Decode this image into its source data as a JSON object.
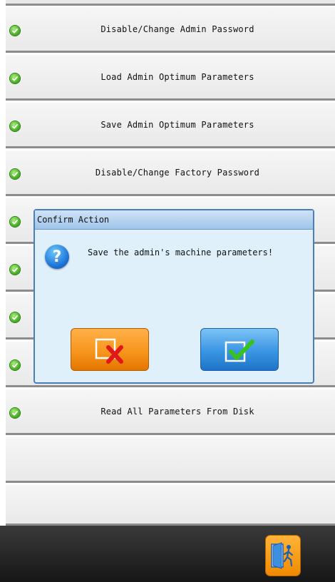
{
  "menu": {
    "items": [
      {
        "label": "Disable/Change Admin Password"
      },
      {
        "label": "Load Admin Optimum Parameters"
      },
      {
        "label": "Save Admin Optimum Parameters"
      },
      {
        "label": "Disable/Change Factory Password"
      },
      {
        "label": ""
      },
      {
        "label": ""
      },
      {
        "label": ""
      },
      {
        "label": ""
      },
      {
        "label": "Read All Parameters From Disk"
      },
      {
        "label": ""
      },
      {
        "label": ""
      }
    ]
  },
  "dialog": {
    "title": "Confirm Action",
    "message": "Save the admin's machine parameters!",
    "cancel_icon": "cancel-x-icon",
    "ok_icon": "confirm-check-icon"
  },
  "footer": {
    "exit_icon": "exit-door-icon"
  },
  "colors": {
    "check_green": "#3ea81c",
    "dialog_border": "#4a7fbf",
    "cancel_orange": "#f7961d",
    "ok_blue": "#3a95e3"
  }
}
